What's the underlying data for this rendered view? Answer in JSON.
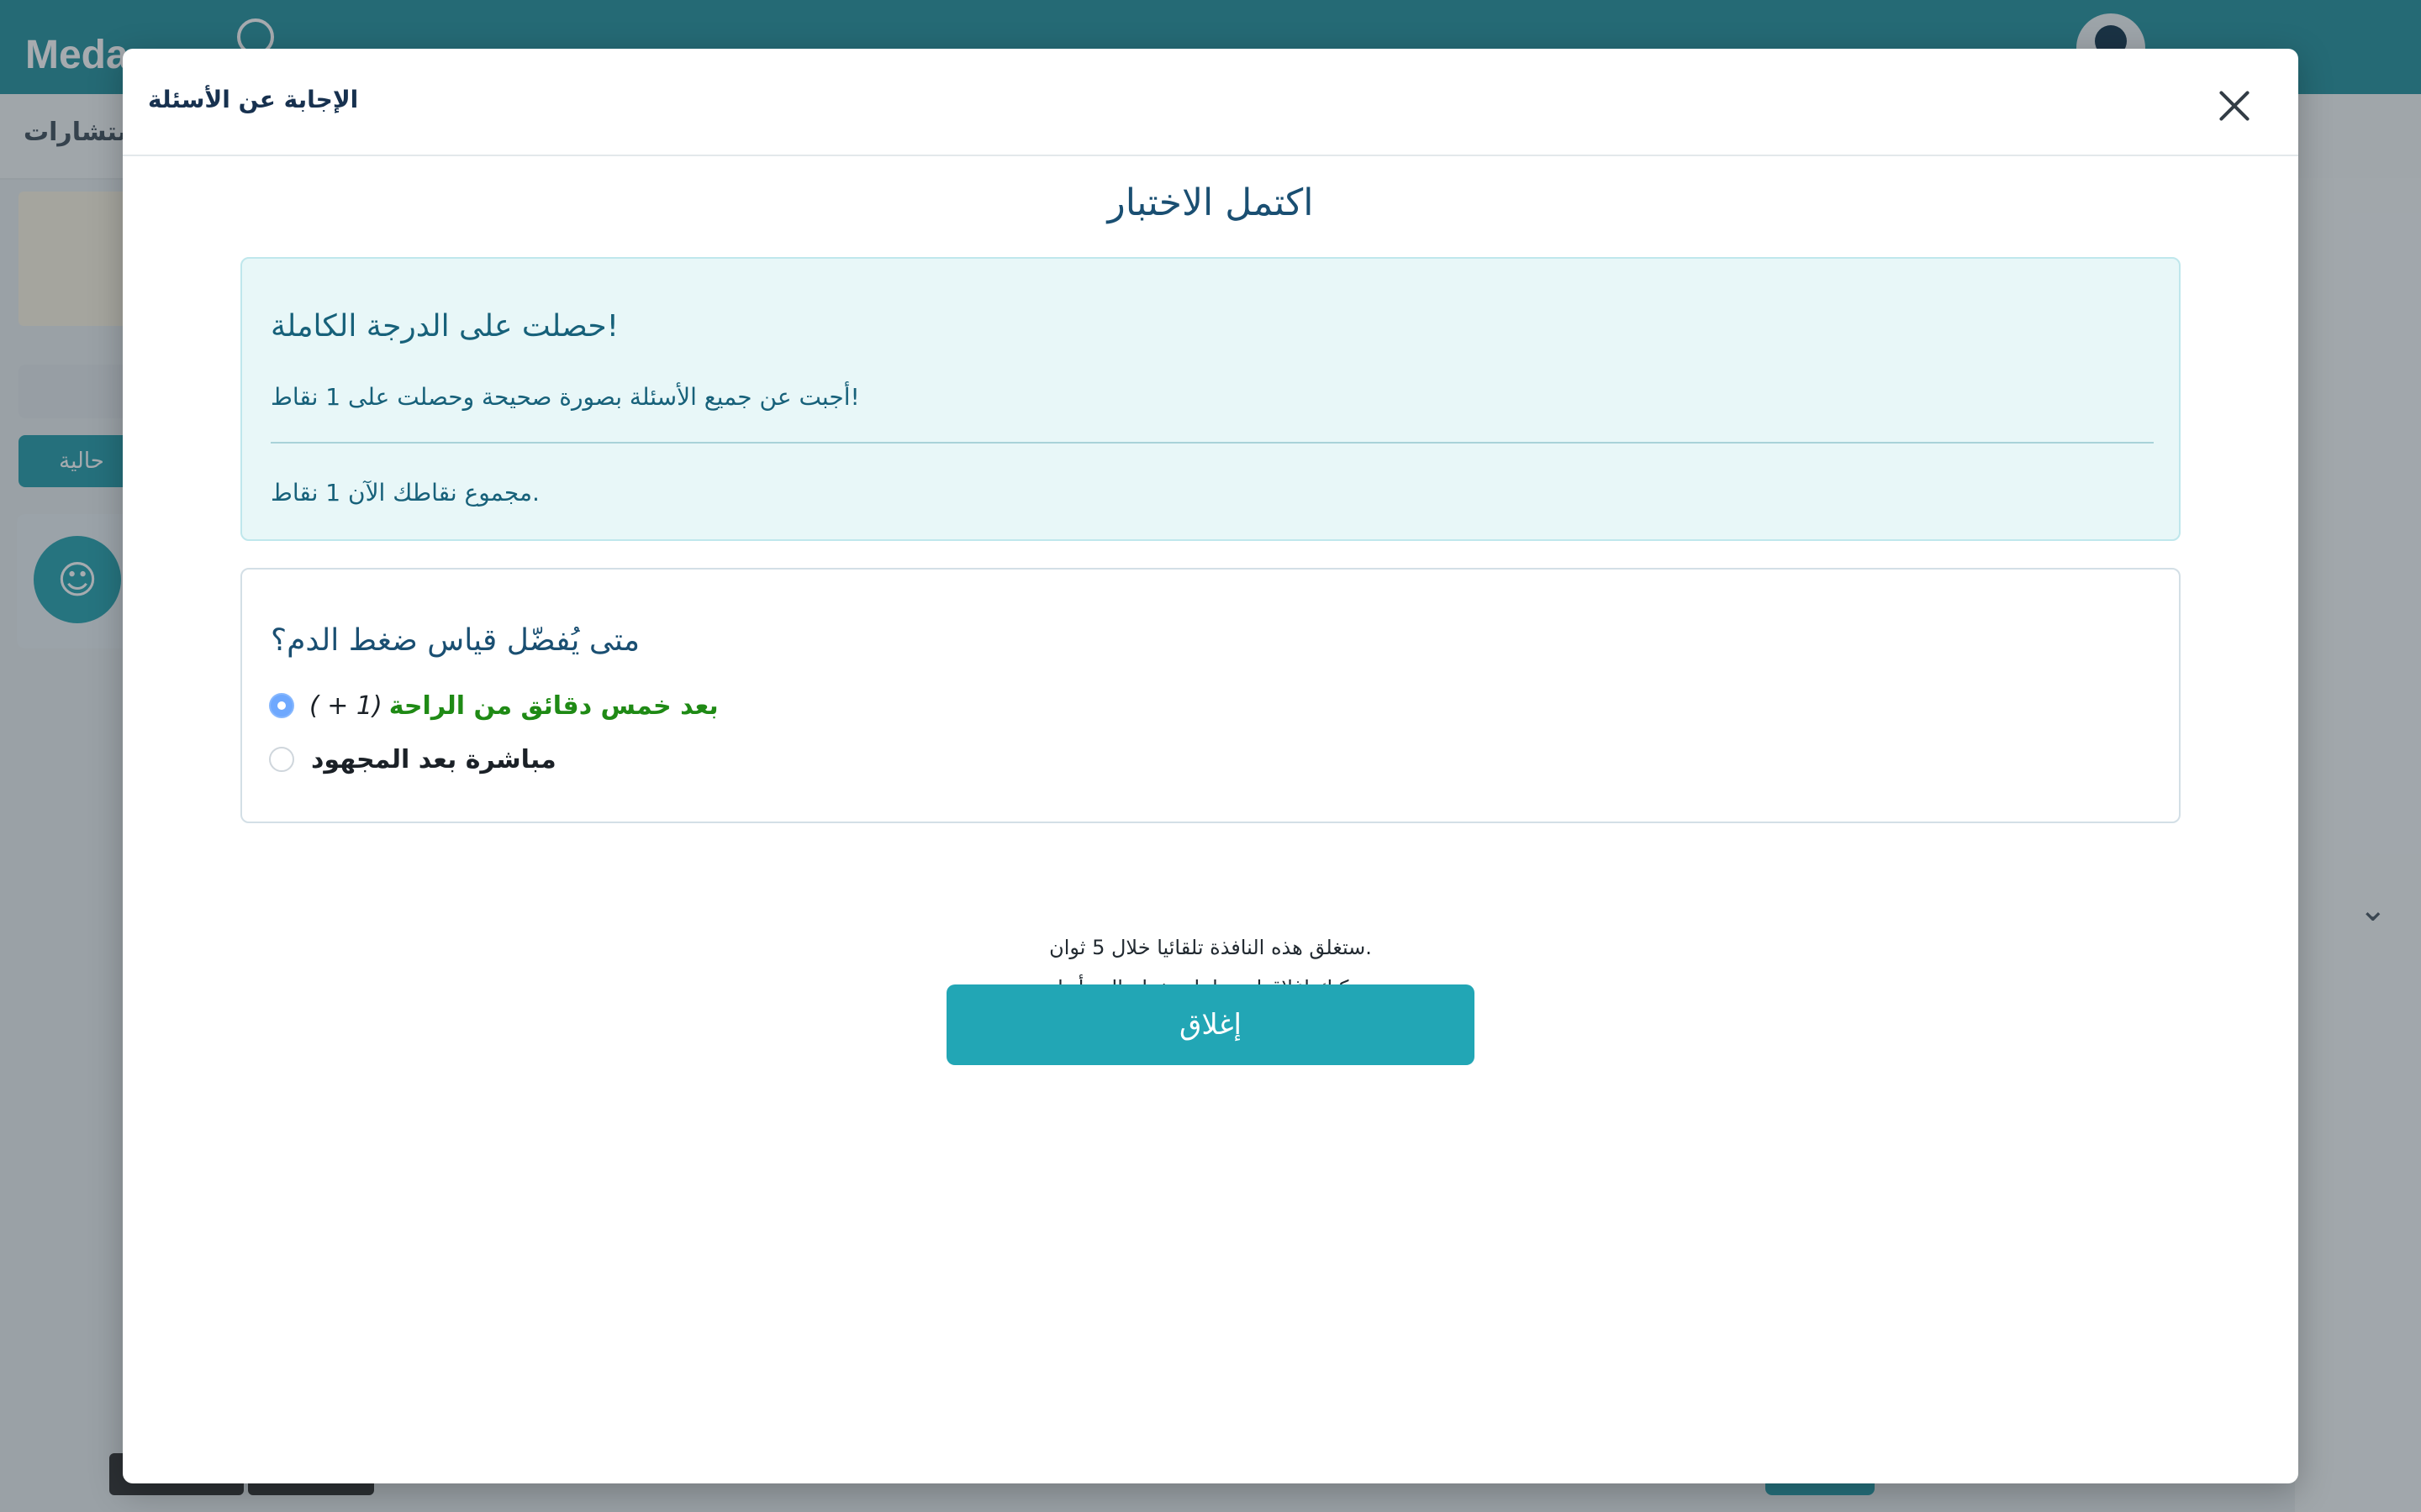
{
  "background": {
    "brand": "Meda",
    "sidebar_button": "حالية",
    "subbar_title": "ستشارات"
  },
  "modal": {
    "title": "الإجابة عن الأسئلة",
    "heading": "اكتمل الاختبار",
    "alert": {
      "title": "!حصلت على الدرجة الكاملة",
      "message": "!أجبت عن جميع الأسئلة بصورة صحيحة وحصلت على 1 نقاط",
      "total": ".مجموع نقاطك الآن 1 نقاط"
    },
    "question": {
      "text": "متى يُفضّل قياس ضغط الدم؟",
      "options": [
        {
          "label": "بعد خمس دقائق من الراحة",
          "points": "( + 1)",
          "selected": true,
          "correct": true
        },
        {
          "label": "مباشرة بعد المجهود",
          "points": "",
          "selected": false,
          "correct": false
        }
      ]
    },
    "auto_close": {
      "line1": ".ستغلق هذه النافذة تلقائيا خلال 5 ثوان",
      "line2": ".يمكنك إغلاقها يدويا باستخدام الزر أدناه"
    },
    "close_button": "إغلاق"
  },
  "colors": {
    "header": "#1f8f9c",
    "primary_button": "#22a6b5",
    "alert_bg": "#e8f7f8",
    "correct_text": "#1f8a15",
    "heading_text": "#1a4f72"
  },
  "icons": {
    "close": "close-icon",
    "user": "user-icon"
  }
}
